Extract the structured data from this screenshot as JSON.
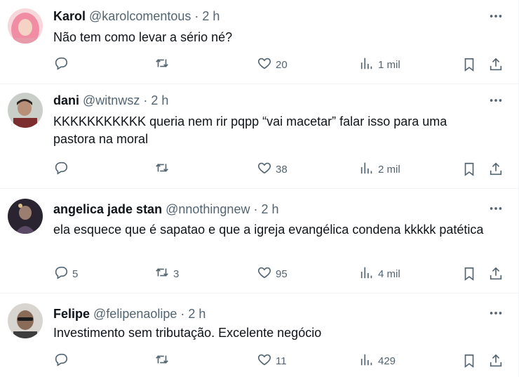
{
  "tweets": [
    {
      "name": "Karol",
      "handle": "@karolcomentous",
      "dot": "·",
      "time": "2 h",
      "text": "Não tem como levar a sério né?",
      "replies": "",
      "retweets": "",
      "likes": "20",
      "views": "1 mil",
      "avatar_color": "#f2a7b4"
    },
    {
      "name": "dani",
      "handle": "@witnwsz",
      "dot": "·",
      "time": "2 h",
      "text": "KKKKKKKKKKK queria nem rir pqpp “vai macetar” falar isso para uma pastora na moral",
      "replies": "",
      "retweets": "",
      "likes": "38",
      "views": "2 mil",
      "avatar_color": "#8a9a8f"
    },
    {
      "name": "angelica jade stan",
      "handle": "@nnothingnew",
      "dot": "·",
      "time": "2 h",
      "text": "ela esquece que é sapatao e que a igreja evangélica condena kkkkk patética",
      "replies": "5",
      "retweets": "3",
      "likes": "95",
      "views": "4 mil",
      "avatar_color": "#3a3142"
    },
    {
      "name": "Felipe",
      "handle": "@felipenaolipe",
      "dot": "·",
      "time": "2 h",
      "text": "Investimento sem tributação. Excelente negócio",
      "replies": "",
      "retweets": "",
      "likes": "11",
      "views": "429",
      "avatar_color": "#6b5a4e"
    }
  ],
  "icons": {
    "reply": "reply-icon",
    "retweet": "retweet-icon",
    "like": "heart-icon",
    "views": "views-chart-icon",
    "bookmark": "bookmark-icon",
    "share": "share-icon",
    "more": "more-dots-icon"
  },
  "colors": {
    "text": "#0f1419",
    "secondary": "#536471",
    "divider": "#eff3f4"
  }
}
